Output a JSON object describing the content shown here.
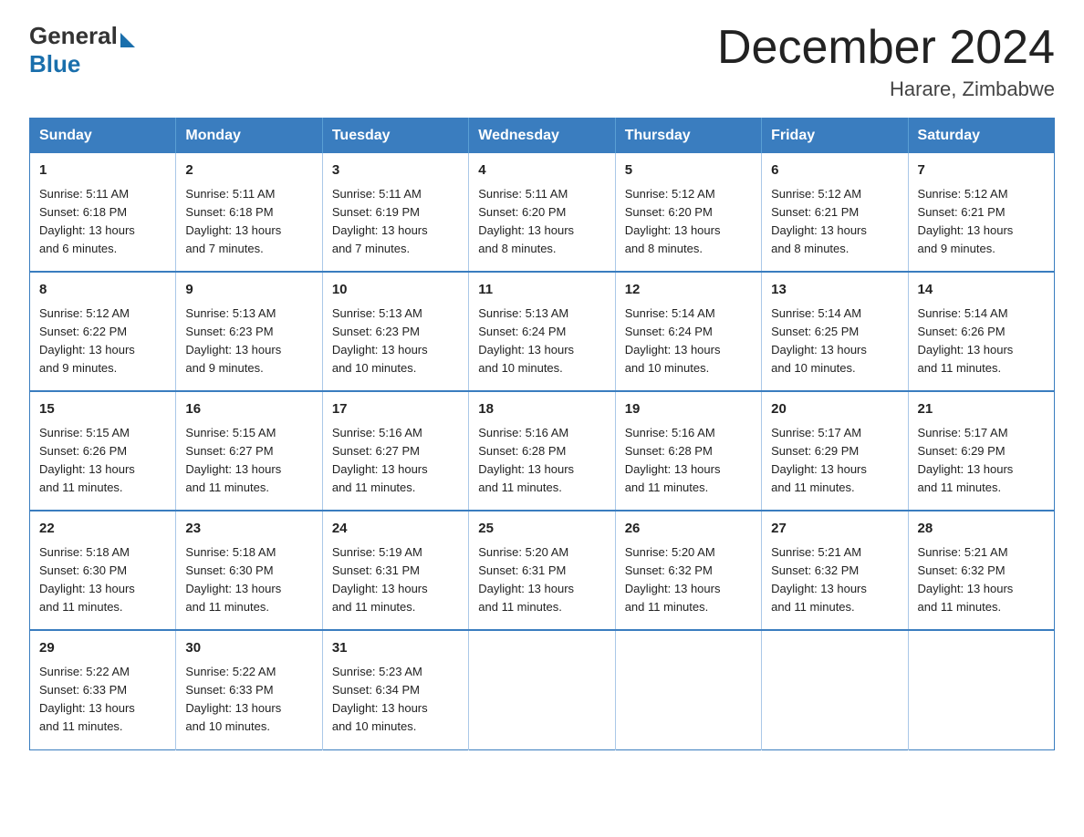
{
  "header": {
    "logo_general": "General",
    "logo_blue": "Blue",
    "month_title": "December 2024",
    "location": "Harare, Zimbabwe"
  },
  "days_of_week": [
    "Sunday",
    "Monday",
    "Tuesday",
    "Wednesday",
    "Thursday",
    "Friday",
    "Saturday"
  ],
  "weeks": [
    [
      {
        "day": "1",
        "sunrise": "5:11 AM",
        "sunset": "6:18 PM",
        "daylight": "13 hours and 6 minutes."
      },
      {
        "day": "2",
        "sunrise": "5:11 AM",
        "sunset": "6:18 PM",
        "daylight": "13 hours and 7 minutes."
      },
      {
        "day": "3",
        "sunrise": "5:11 AM",
        "sunset": "6:19 PM",
        "daylight": "13 hours and 7 minutes."
      },
      {
        "day": "4",
        "sunrise": "5:11 AM",
        "sunset": "6:20 PM",
        "daylight": "13 hours and 8 minutes."
      },
      {
        "day": "5",
        "sunrise": "5:12 AM",
        "sunset": "6:20 PM",
        "daylight": "13 hours and 8 minutes."
      },
      {
        "day": "6",
        "sunrise": "5:12 AM",
        "sunset": "6:21 PM",
        "daylight": "13 hours and 8 minutes."
      },
      {
        "day": "7",
        "sunrise": "5:12 AM",
        "sunset": "6:21 PM",
        "daylight": "13 hours and 9 minutes."
      }
    ],
    [
      {
        "day": "8",
        "sunrise": "5:12 AM",
        "sunset": "6:22 PM",
        "daylight": "13 hours and 9 minutes."
      },
      {
        "day": "9",
        "sunrise": "5:13 AM",
        "sunset": "6:23 PM",
        "daylight": "13 hours and 9 minutes."
      },
      {
        "day": "10",
        "sunrise": "5:13 AM",
        "sunset": "6:23 PM",
        "daylight": "13 hours and 10 minutes."
      },
      {
        "day": "11",
        "sunrise": "5:13 AM",
        "sunset": "6:24 PM",
        "daylight": "13 hours and 10 minutes."
      },
      {
        "day": "12",
        "sunrise": "5:14 AM",
        "sunset": "6:24 PM",
        "daylight": "13 hours and 10 minutes."
      },
      {
        "day": "13",
        "sunrise": "5:14 AM",
        "sunset": "6:25 PM",
        "daylight": "13 hours and 10 minutes."
      },
      {
        "day": "14",
        "sunrise": "5:14 AM",
        "sunset": "6:26 PM",
        "daylight": "13 hours and 11 minutes."
      }
    ],
    [
      {
        "day": "15",
        "sunrise": "5:15 AM",
        "sunset": "6:26 PM",
        "daylight": "13 hours and 11 minutes."
      },
      {
        "day": "16",
        "sunrise": "5:15 AM",
        "sunset": "6:27 PM",
        "daylight": "13 hours and 11 minutes."
      },
      {
        "day": "17",
        "sunrise": "5:16 AM",
        "sunset": "6:27 PM",
        "daylight": "13 hours and 11 minutes."
      },
      {
        "day": "18",
        "sunrise": "5:16 AM",
        "sunset": "6:28 PM",
        "daylight": "13 hours and 11 minutes."
      },
      {
        "day": "19",
        "sunrise": "5:16 AM",
        "sunset": "6:28 PM",
        "daylight": "13 hours and 11 minutes."
      },
      {
        "day": "20",
        "sunrise": "5:17 AM",
        "sunset": "6:29 PM",
        "daylight": "13 hours and 11 minutes."
      },
      {
        "day": "21",
        "sunrise": "5:17 AM",
        "sunset": "6:29 PM",
        "daylight": "13 hours and 11 minutes."
      }
    ],
    [
      {
        "day": "22",
        "sunrise": "5:18 AM",
        "sunset": "6:30 PM",
        "daylight": "13 hours and 11 minutes."
      },
      {
        "day": "23",
        "sunrise": "5:18 AM",
        "sunset": "6:30 PM",
        "daylight": "13 hours and 11 minutes."
      },
      {
        "day": "24",
        "sunrise": "5:19 AM",
        "sunset": "6:31 PM",
        "daylight": "13 hours and 11 minutes."
      },
      {
        "day": "25",
        "sunrise": "5:20 AM",
        "sunset": "6:31 PM",
        "daylight": "13 hours and 11 minutes."
      },
      {
        "day": "26",
        "sunrise": "5:20 AM",
        "sunset": "6:32 PM",
        "daylight": "13 hours and 11 minutes."
      },
      {
        "day": "27",
        "sunrise": "5:21 AM",
        "sunset": "6:32 PM",
        "daylight": "13 hours and 11 minutes."
      },
      {
        "day": "28",
        "sunrise": "5:21 AM",
        "sunset": "6:32 PM",
        "daylight": "13 hours and 11 minutes."
      }
    ],
    [
      {
        "day": "29",
        "sunrise": "5:22 AM",
        "sunset": "6:33 PM",
        "daylight": "13 hours and 11 minutes."
      },
      {
        "day": "30",
        "sunrise": "5:22 AM",
        "sunset": "6:33 PM",
        "daylight": "13 hours and 10 minutes."
      },
      {
        "day": "31",
        "sunrise": "5:23 AM",
        "sunset": "6:34 PM",
        "daylight": "13 hours and 10 minutes."
      },
      null,
      null,
      null,
      null
    ]
  ],
  "labels": {
    "sunrise": "Sunrise:",
    "sunset": "Sunset:",
    "daylight": "Daylight:"
  }
}
